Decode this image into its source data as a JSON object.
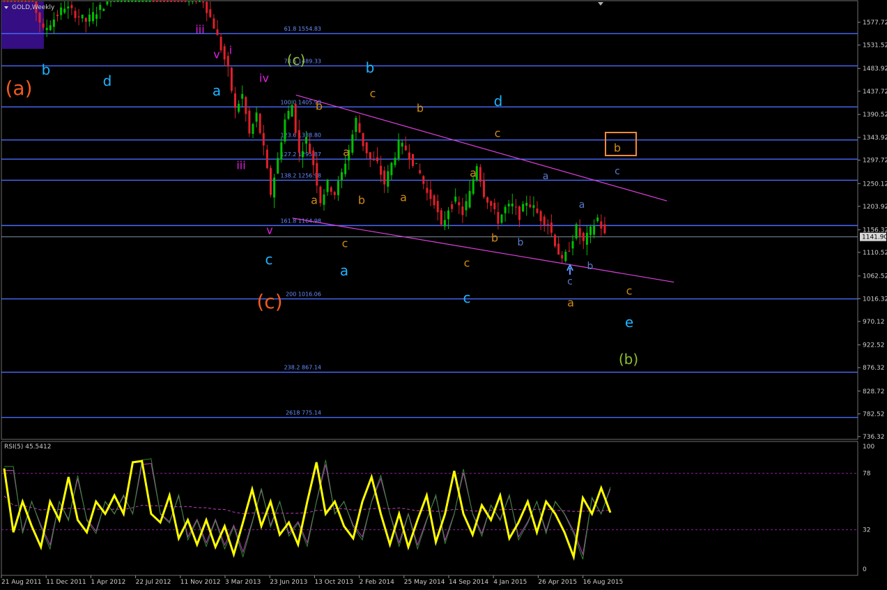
{
  "window": {
    "title": "GOLD,Weekly"
  },
  "indicator": {
    "label": "RSI(5) 45.5412"
  },
  "colors": {
    "background": "#000000",
    "bull": "#00c000",
    "bear": "#e0202a",
    "fib": "#4a6cff",
    "channel": "#e040e0",
    "rsi": "#ffff00",
    "rsi_ma_fast": "#2e8b2e",
    "rsi_ma_slow": "#c040c0",
    "rsi_levels": "#9020a0",
    "label_orange": "#f05a20",
    "label_cyan": "#1eb4ff",
    "label_gold": "#d08a18",
    "label_magenta": "#e020e0",
    "label_olive": "#90c030",
    "label_steel": "#5a7ac8",
    "current_price": "#8090a0",
    "box_orange": "#f08a3c"
  },
  "chart_data": {
    "type": "candlestick",
    "title": "GOLD,Weekly",
    "price_axis": {
      "ticks": [
        "1577.72",
        "1531.52",
        "1483.92",
        "1437.72",
        "1390.52",
        "1343.92",
        "1297.72",
        "1250.12",
        "1203.92",
        "1156.32",
        "1110.52",
        "1062.52",
        "1016.32",
        "970.12",
        "922.52",
        "876.32",
        "828.72",
        "782.52",
        "736.32"
      ],
      "current_price": "1141.90",
      "ylim": [
        736.32,
        1624
      ]
    },
    "time_axis": {
      "labels": [
        "21 Aug 2011",
        "11 Dec 2011",
        "1 Apr 2012",
        "22 Jul 2012",
        "11 Nov 2012",
        "3 Mar 2013",
        "23 Jun 2013",
        "13 Oct 2013",
        "2 Feb 2014",
        "25 May 2014",
        "14 Sep 2014",
        "4 Jan 2015",
        "26 Apr 2015",
        "16 Aug 2015"
      ]
    },
    "price_anchors": [
      {
        "week": 0,
        "price": 1700
      },
      {
        "week": 6,
        "price": 1680
      },
      {
        "week": 12,
        "price": 1560
      },
      {
        "week": 18,
        "price": 1610
      },
      {
        "week": 24,
        "price": 1580
      },
      {
        "week": 30,
        "price": 1620
      },
      {
        "week": 36,
        "price": 1700
      },
      {
        "week": 42,
        "price": 1720
      },
      {
        "week": 48,
        "price": 1660
      },
      {
        "week": 54,
        "price": 1620
      },
      {
        "week": 56,
        "price": 1640
      },
      {
        "week": 60,
        "price": 1570
      },
      {
        "week": 64,
        "price": 1480
      },
      {
        "week": 66,
        "price": 1400
      },
      {
        "week": 68,
        "price": 1430
      },
      {
        "week": 70,
        "price": 1350
      },
      {
        "week": 72,
        "price": 1390
      },
      {
        "week": 74,
        "price": 1320
      },
      {
        "week": 76,
        "price": 1230
      },
      {
        "week": 78,
        "price": 1300
      },
      {
        "week": 80,
        "price": 1380
      },
      {
        "week": 82,
        "price": 1410
      },
      {
        "week": 84,
        "price": 1310
      },
      {
        "week": 86,
        "price": 1340
      },
      {
        "week": 88,
        "price": 1290
      },
      {
        "week": 90,
        "price": 1215
      },
      {
        "week": 92,
        "price": 1250
      },
      {
        "week": 94,
        "price": 1230
      },
      {
        "week": 96,
        "price": 1270
      },
      {
        "week": 98,
        "price": 1320
      },
      {
        "week": 100,
        "price": 1380
      },
      {
        "week": 102,
        "price": 1330
      },
      {
        "week": 104,
        "price": 1300
      },
      {
        "week": 106,
        "price": 1290
      },
      {
        "week": 108,
        "price": 1250
      },
      {
        "week": 110,
        "price": 1290
      },
      {
        "week": 112,
        "price": 1330
      },
      {
        "week": 114,
        "price": 1320
      },
      {
        "week": 116,
        "price": 1295
      },
      {
        "week": 118,
        "price": 1270
      },
      {
        "week": 120,
        "price": 1230
      },
      {
        "week": 122,
        "price": 1215
      },
      {
        "week": 124,
        "price": 1160
      },
      {
        "week": 126,
        "price": 1200
      },
      {
        "week": 128,
        "price": 1215
      },
      {
        "week": 130,
        "price": 1190
      },
      {
        "week": 132,
        "price": 1230
      },
      {
        "week": 134,
        "price": 1290
      },
      {
        "week": 136,
        "price": 1230
      },
      {
        "week": 138,
        "price": 1205
      },
      {
        "week": 140,
        "price": 1175
      },
      {
        "week": 142,
        "price": 1200
      },
      {
        "week": 144,
        "price": 1205
      },
      {
        "week": 146,
        "price": 1185
      },
      {
        "week": 148,
        "price": 1215
      },
      {
        "week": 150,
        "price": 1200
      },
      {
        "week": 152,
        "price": 1180
      },
      {
        "week": 154,
        "price": 1170
      },
      {
        "week": 156,
        "price": 1130
      },
      {
        "week": 158,
        "price": 1090
      },
      {
        "week": 160,
        "price": 1120
      },
      {
        "week": 162,
        "price": 1160
      },
      {
        "week": 164,
        "price": 1130
      },
      {
        "week": 166,
        "price": 1155
      },
      {
        "week": 168,
        "price": 1180
      },
      {
        "week": 170,
        "price": 1145
      }
    ],
    "rsi_anchors": [
      {
        "week": 0,
        "value": 82
      },
      {
        "week": 3,
        "value": 30
      },
      {
        "week": 6,
        "value": 55
      },
      {
        "week": 9,
        "value": 35
      },
      {
        "week": 12,
        "value": 18
      },
      {
        "week": 15,
        "value": 55
      },
      {
        "week": 18,
        "value": 40
      },
      {
        "week": 21,
        "value": 75
      },
      {
        "week": 24,
        "value": 40
      },
      {
        "week": 27,
        "value": 30
      },
      {
        "week": 30,
        "value": 55
      },
      {
        "week": 33,
        "value": 45
      },
      {
        "week": 36,
        "value": 60
      },
      {
        "week": 39,
        "value": 45
      },
      {
        "week": 42,
        "value": 87
      },
      {
        "week": 45,
        "value": 88
      },
      {
        "week": 48,
        "value": 45
      },
      {
        "week": 51,
        "value": 38
      },
      {
        "week": 54,
        "value": 60
      },
      {
        "week": 57,
        "value": 25
      },
      {
        "week": 60,
        "value": 40
      },
      {
        "week": 63,
        "value": 20
      },
      {
        "week": 66,
        "value": 40
      },
      {
        "week": 69,
        "value": 18
      },
      {
        "week": 72,
        "value": 35
      },
      {
        "week": 75,
        "value": 12
      },
      {
        "week": 78,
        "value": 38
      },
      {
        "week": 81,
        "value": 65
      },
      {
        "week": 84,
        "value": 35
      },
      {
        "week": 87,
        "value": 55
      },
      {
        "week": 90,
        "value": 28
      },
      {
        "week": 93,
        "value": 38
      },
      {
        "week": 96,
        "value": 20
      },
      {
        "week": 99,
        "value": 55
      },
      {
        "week": 102,
        "value": 87
      },
      {
        "week": 105,
        "value": 45
      },
      {
        "week": 108,
        "value": 55
      },
      {
        "week": 111,
        "value": 35
      },
      {
        "week": 114,
        "value": 25
      },
      {
        "week": 117,
        "value": 55
      },
      {
        "week": 120,
        "value": 75
      },
      {
        "week": 123,
        "value": 45
      },
      {
        "week": 126,
        "value": 20
      },
      {
        "week": 129,
        "value": 45
      },
      {
        "week": 132,
        "value": 18
      },
      {
        "week": 135,
        "value": 40
      },
      {
        "week": 138,
        "value": 60
      },
      {
        "week": 141,
        "value": 22
      },
      {
        "week": 144,
        "value": 45
      },
      {
        "week": 147,
        "value": 80
      },
      {
        "week": 150,
        "value": 45
      },
      {
        "week": 153,
        "value": 28
      },
      {
        "week": 156,
        "value": 52
      },
      {
        "week": 159,
        "value": 40
      },
      {
        "week": 162,
        "value": 60
      },
      {
        "week": 165,
        "value": 25
      },
      {
        "week": 168,
        "value": 38
      },
      {
        "week": 171,
        "value": 55
      },
      {
        "week": 174,
        "value": 30
      },
      {
        "week": 177,
        "value": 55
      },
      {
        "week": 180,
        "value": 45
      },
      {
        "week": 183,
        "value": 30
      },
      {
        "week": 186,
        "value": 10
      },
      {
        "week": 189,
        "value": 58
      },
      {
        "week": 192,
        "value": 45
      },
      {
        "week": 195,
        "value": 66
      },
      {
        "week": 198,
        "value": 46
      }
    ],
    "fib_levels": [
      {
        "label": "61.8 1554.83",
        "price": 1554.83
      },
      {
        "label": "78.6 1489.33",
        "price": 1489.33
      },
      {
        "label": "100.0 1405.90",
        "price": 1405.9
      },
      {
        "label": "123.6 1338.80",
        "price": 1338.8
      },
      {
        "label": "127.2 1295.87",
        "price": 1299.8
      },
      {
        "label": "138.2 1256.98",
        "price": 1256.98
      },
      {
        "label": "161.8 1164.98",
        "price": 1164.98
      },
      {
        "label": "200 1016.06",
        "price": 1016.06
      },
      {
        "label": "238.2 867.14",
        "price": 867.14
      },
      {
        "label": "2618 775.14",
        "price": 775.14
      }
    ],
    "channel": {
      "upper": [
        {
          "x_week": 88,
          "price": 1430
        },
        {
          "x_week": 210,
          "price": 1215
        }
      ],
      "lower": [
        {
          "x_week": 87,
          "price": 1180
        },
        {
          "x_week": 212,
          "price": 1050
        }
      ]
    },
    "rsi": {
      "name": "RSI(5)",
      "value": "45.5412",
      "levels": [
        "100",
        "78",
        "32",
        "0"
      ],
      "ylim": [
        0,
        100
      ]
    },
    "wave_labels": [
      {
        "text": "(a)",
        "color": "label_orange",
        "size": 28
      },
      {
        "text": "b",
        "color": "label_cyan",
        "size": 20
      },
      {
        "text": "d",
        "color": "label_cyan",
        "size": 20
      },
      {
        "text": "a",
        "color": "label_cyan",
        "size": 20
      },
      {
        "text": "iii",
        "color": "label_magenta",
        "size": 16
      },
      {
        "text": "v",
        "color": "label_magenta",
        "size": 16
      },
      {
        "text": "i",
        "color": "label_magenta",
        "size": 16
      },
      {
        "text": "iv",
        "color": "label_magenta",
        "size": 16
      },
      {
        "text": "iii",
        "color": "label_magenta",
        "size": 16
      },
      {
        "text": "v",
        "color": "label_magenta",
        "size": 16
      },
      {
        "text": "c",
        "color": "label_cyan",
        "size": 20
      },
      {
        "text": "(c)",
        "color": "label_orange",
        "size": 28
      },
      {
        "text": "(c)",
        "color": "label_olive",
        "size": 20
      },
      {
        "text": "b",
        "color": "label_gold",
        "size": 16
      },
      {
        "text": "a",
        "color": "label_gold",
        "size": 16
      },
      {
        "text": "a",
        "color": "label_gold",
        "size": 16
      },
      {
        "text": "b",
        "color": "label_gold",
        "size": 16
      },
      {
        "text": "c",
        "color": "label_gold",
        "size": 16
      },
      {
        "text": "a",
        "color": "label_cyan",
        "size": 20
      },
      {
        "text": "b",
        "color": "label_cyan",
        "size": 20
      },
      {
        "text": "c",
        "color": "label_gold",
        "size": 16
      },
      {
        "text": "b",
        "color": "label_gold",
        "size": 16
      },
      {
        "text": "a",
        "color": "label_gold",
        "size": 16
      },
      {
        "text": "a",
        "color": "label_gold",
        "size": 16
      },
      {
        "text": "c",
        "color": "label_gold",
        "size": 16
      },
      {
        "text": "c",
        "color": "label_cyan",
        "size": 20
      },
      {
        "text": "d",
        "color": "label_cyan",
        "size": 20
      },
      {
        "text": "c",
        "color": "label_gold",
        "size": 16
      },
      {
        "text": "b",
        "color": "label_gold",
        "size": 16
      },
      {
        "text": "a",
        "color": "label_steel",
        "size": 14
      },
      {
        "text": "b",
        "color": "label_steel",
        "size": 14
      },
      {
        "text": "a",
        "color": "label_steel",
        "size": 14
      },
      {
        "text": "b",
        "color": "label_steel",
        "size": 14
      },
      {
        "text": "c",
        "color": "label_steel",
        "size": 14
      },
      {
        "text": "a",
        "color": "label_gold",
        "size": 16
      },
      {
        "text": "c",
        "color": "label_steel",
        "size": 14
      },
      {
        "text": "b",
        "color": "label_gold",
        "size": 16
      },
      {
        "text": "c",
        "color": "label_gold",
        "size": 16
      },
      {
        "text": "e",
        "color": "label_cyan",
        "size": 20
      },
      {
        "text": "(b)",
        "color": "label_olive",
        "size": 20
      }
    ],
    "grid": false
  }
}
